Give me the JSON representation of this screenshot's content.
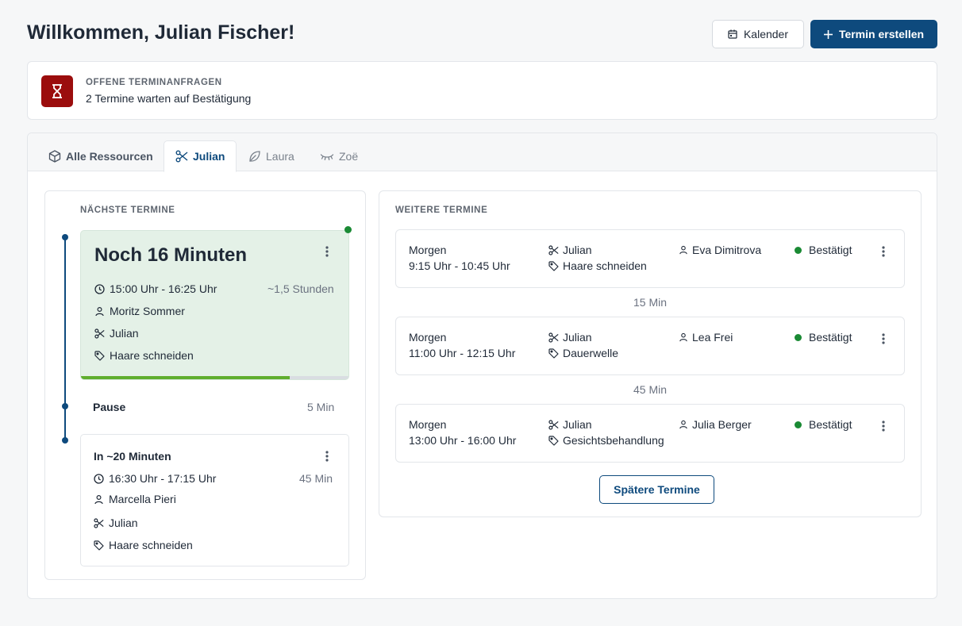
{
  "header": {
    "title": "Willkommen, Julian Fischer!",
    "calendar_label": "Kalender",
    "create_label": "Termin erstellen"
  },
  "notice": {
    "heading": "OFFENE TERMINANFRAGEN",
    "text": "2 Termine warten auf Bestätigung",
    "icon": "hourglass-icon",
    "color": "#9b0d0d"
  },
  "tabs": [
    {
      "label": "Alle Ressourcen",
      "icon": "cube-icon"
    },
    {
      "label": "Julian",
      "icon": "scissors-icon",
      "active": true
    },
    {
      "label": "Laura",
      "icon": "leaf-icon"
    },
    {
      "label": "Zoë",
      "icon": "eyelash-icon"
    }
  ],
  "next": {
    "section_label": "NÄCHSTE TERMINE",
    "current": {
      "countdown": "Noch 16 Minuten",
      "time": "15:00 Uhr - 16:25 Uhr",
      "duration": "~1,5 Stunden",
      "client": "Moritz Sommer",
      "staff": "Julian",
      "service": "Haare schneiden",
      "progress_percent": 78
    },
    "pause": {
      "label": "Pause",
      "duration": "5 Min"
    },
    "upcoming": {
      "countdown": "In ~20 Minuten",
      "time": "16:30 Uhr - 17:15 Uhr",
      "duration": "45 Min",
      "client": "Marcella Pieri",
      "staff": "Julian",
      "service": "Haare schneiden"
    }
  },
  "further": {
    "section_label": "WEITERE TERMINE",
    "appointments": [
      {
        "day": "Morgen",
        "time": "9:15 Uhr - 10:45 Uhr",
        "staff": "Julian",
        "service": "Haare schneiden",
        "client": "Eva Dimitrova",
        "status": "Bestätigt"
      },
      {
        "day": "Morgen",
        "time": "11:00 Uhr - 12:15 Uhr",
        "staff": "Julian",
        "service": "Dauerwelle",
        "client": "Lea Frei",
        "status": "Bestätigt"
      },
      {
        "day": "Morgen",
        "time": "13:00 Uhr - 16:00 Uhr",
        "staff": "Julian",
        "service": "Gesichtsbehandlung",
        "client": "Julia Berger",
        "status": "Bestätigt"
      }
    ],
    "gaps": [
      "15 Min",
      "45 Min"
    ],
    "later_label": "Spätere Termine"
  },
  "colors": {
    "primary": "#0e4a7d",
    "success": "#1a8a34",
    "progress": "#5fae2e",
    "current_bg": "#e4f1e7"
  }
}
